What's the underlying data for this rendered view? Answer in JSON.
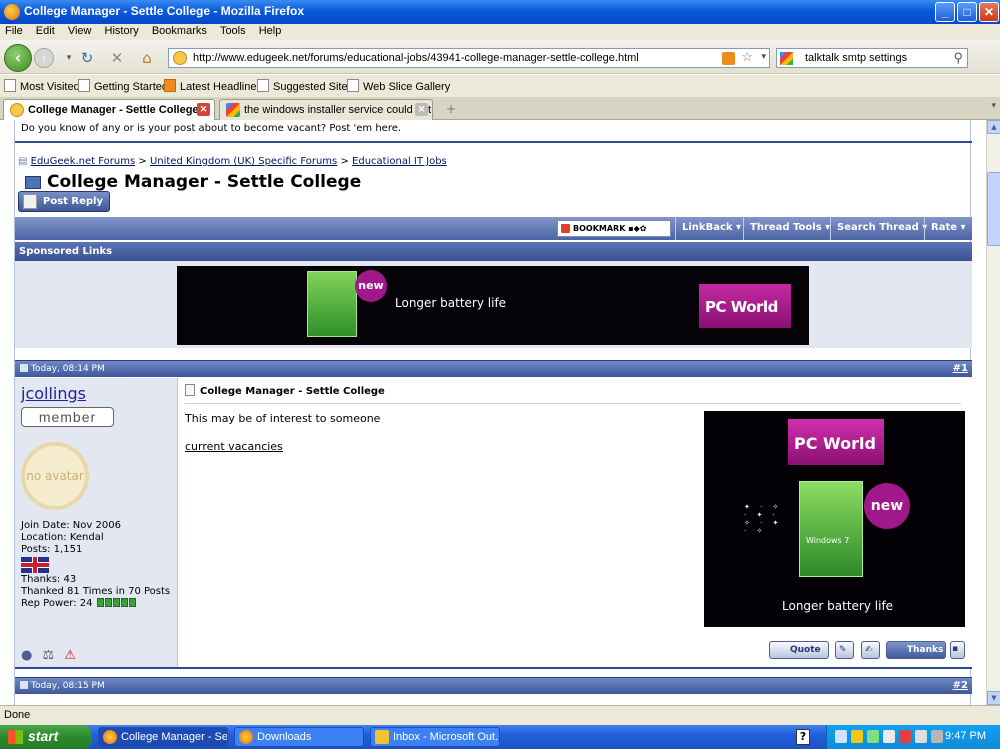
{
  "window": {
    "title": "College Manager - Settle College - Mozilla Firefox",
    "minimize": "_",
    "maximize": "□",
    "close": "✕"
  },
  "menu": [
    "File",
    "Edit",
    "View",
    "History",
    "Bookmarks",
    "Tools",
    "Help"
  ],
  "nav": {
    "url": "http://www.edugeek.net/forums/educational-jobs/43941-college-manager-settle-college.html",
    "search_value": "talktalk smtp settings"
  },
  "bookmarks": [
    "Most Visited",
    "Getting Started",
    "Latest Headlines",
    "Suggested Sites",
    "Web Slice Gallery"
  ],
  "tabs": [
    {
      "label": "College Manager - Settle College",
      "active": true
    },
    {
      "label": "the windows installer service could not ...",
      "active": false
    }
  ],
  "page": {
    "notice": "Do you know of any or is your post about to become vacant? Post 'em here.",
    "breadcrumb": [
      "EduGeek.net Forums",
      "United Kingdom (UK) Specific Forums",
      "Educational IT Jobs"
    ],
    "breadcrumb_sep": ">",
    "thread_title": "College Manager - Settle College",
    "post_reply": "Post Reply",
    "bookmark_label": "BOOKMARK",
    "tools": [
      "LinkBack ▾",
      "Thread Tools ▾",
      "Search Thread ▾",
      "Rate ▾"
    ],
    "sponsored": "Sponsored Links",
    "ad_banner": {
      "badge": "new",
      "tagline": "Longer battery life",
      "brand": "PC World"
    },
    "post1": {
      "date": "Today, 08:14 PM",
      "number": "#1",
      "username": "jcollings",
      "rank": "member",
      "avatar": "no avatar",
      "join_date": "Join Date: Nov 2006",
      "location": "Location: Kendal",
      "posts": "Posts: 1,151",
      "thanks": "Thanks: 43",
      "thanked": "Thanked 81 Times in 70 Posts",
      "rep": "Rep Power: 24",
      "title": "College Manager - Settle College",
      "message": "This may be of interest to someone",
      "link": "current vacancies",
      "ad": {
        "brand": "PC World",
        "badge": "new",
        "tagline": "Longer battery life",
        "product": "Windows 7"
      },
      "quote": "Quote",
      "thanks_button": "Thanks"
    },
    "post2": {
      "date": "Today, 08:15 PM",
      "number": "#2"
    }
  },
  "status": "Done",
  "taskbar": {
    "start": "start",
    "tasks": [
      "College Manager - Se...",
      "Downloads",
      "Inbox - Microsoft Out..."
    ],
    "help": "?",
    "clock": "9:47 PM"
  }
}
